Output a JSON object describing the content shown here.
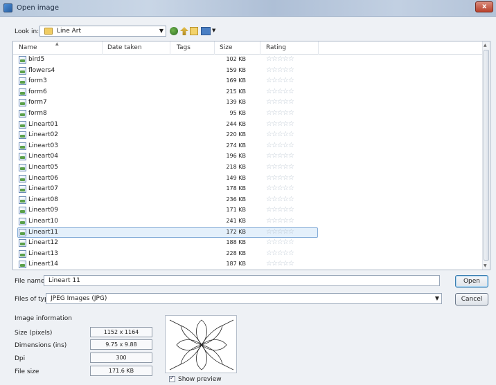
{
  "window": {
    "title": "Open image"
  },
  "toolbar": {
    "look_in_label": "Look in:",
    "look_in_value": "Line Art",
    "icons": [
      "back-icon",
      "up-folder-icon",
      "new-folder-icon",
      "view-menu-icon"
    ]
  },
  "columns": [
    "Name",
    "Date taken",
    "Tags",
    "Size",
    "Rating"
  ],
  "files": [
    {
      "name": "bird5",
      "size": "102 KB"
    },
    {
      "name": "flowers4",
      "size": "159 KB"
    },
    {
      "name": "form3",
      "size": "169 KB"
    },
    {
      "name": "form6",
      "size": "215 KB"
    },
    {
      "name": "form7",
      "size": "139 KB"
    },
    {
      "name": "form8",
      "size": "95 KB"
    },
    {
      "name": "Lineart01",
      "size": "244 KB"
    },
    {
      "name": "Lineart02",
      "size": "220 KB"
    },
    {
      "name": "Lineart03",
      "size": "274 KB"
    },
    {
      "name": "Lineart04",
      "size": "196 KB"
    },
    {
      "name": "Lineart05",
      "size": "218 KB"
    },
    {
      "name": "Lineart06",
      "size": "149 KB"
    },
    {
      "name": "Lineart07",
      "size": "178 KB"
    },
    {
      "name": "Lineart08",
      "size": "236 KB"
    },
    {
      "name": "Lineart09",
      "size": "171 KB"
    },
    {
      "name": "Lineart10",
      "size": "241 KB"
    },
    {
      "name": "Lineart11",
      "size": "172 KB",
      "selected": true
    },
    {
      "name": "Lineart12",
      "size": "188 KB"
    },
    {
      "name": "Lineart13",
      "size": "228 KB"
    },
    {
      "name": "Lineart14",
      "size": "187 KB"
    }
  ],
  "rating_glyphs": "☆☆☆☆☆",
  "filename": {
    "label": "File name:",
    "value": "Lineart 11"
  },
  "filetype": {
    "label": "Files of type:",
    "value": "JPEG Images (JPG)"
  },
  "buttons": {
    "open": "Open",
    "cancel": "Cancel"
  },
  "image_info": {
    "title": "Image information",
    "size_label": "Size (pixels)",
    "size_value": "1152 x 1164",
    "dimensions_label": "Dimensions (ins)",
    "dimensions_value": "9.75 x 9.88",
    "dpi_label": "Dpi",
    "dpi_value": "300",
    "filesize_label": "File size",
    "filesize_value": "171.6 KB"
  },
  "preview": {
    "show_label": "Show preview",
    "checked": true
  }
}
